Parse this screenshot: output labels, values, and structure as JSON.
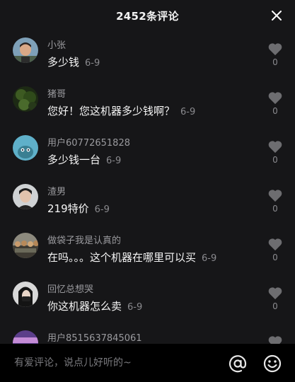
{
  "header": {
    "title": "2452条评论"
  },
  "comments": [
    {
      "user": "小张",
      "text": "多少钱",
      "date": "6-9",
      "likes": "0"
    },
    {
      "user": "猪哥",
      "text": "您好！您这机器多少钱啊？",
      "date": "6-9",
      "likes": "0"
    },
    {
      "user": "用户60772651828",
      "text": "多少钱一台",
      "date": "6-9",
      "likes": "0"
    },
    {
      "user": "渣男",
      "text": "219特价",
      "date": "6-9",
      "likes": "0"
    },
    {
      "user": "做袋子我是认真的",
      "text": "在吗。。。这个机器在哪里可以买",
      "date": "6-9",
      "likes": "0"
    },
    {
      "user": "回忆总想哭",
      "text": "你这机器怎么卖",
      "date": "6-9",
      "likes": "0"
    },
    {
      "user": "用户8515637845061",
      "text": "",
      "date": "",
      "likes": ""
    }
  ],
  "input": {
    "placeholder": "有爱评论，说点儿好听的~"
  },
  "icons": {
    "close": "close-icon",
    "like": "heart-icon",
    "mention": "at-icon",
    "emoji": "emoji-icon"
  },
  "colors": {
    "background": "#161618",
    "bottom_bar": "#000000",
    "like_heart": "#6d6d70"
  }
}
